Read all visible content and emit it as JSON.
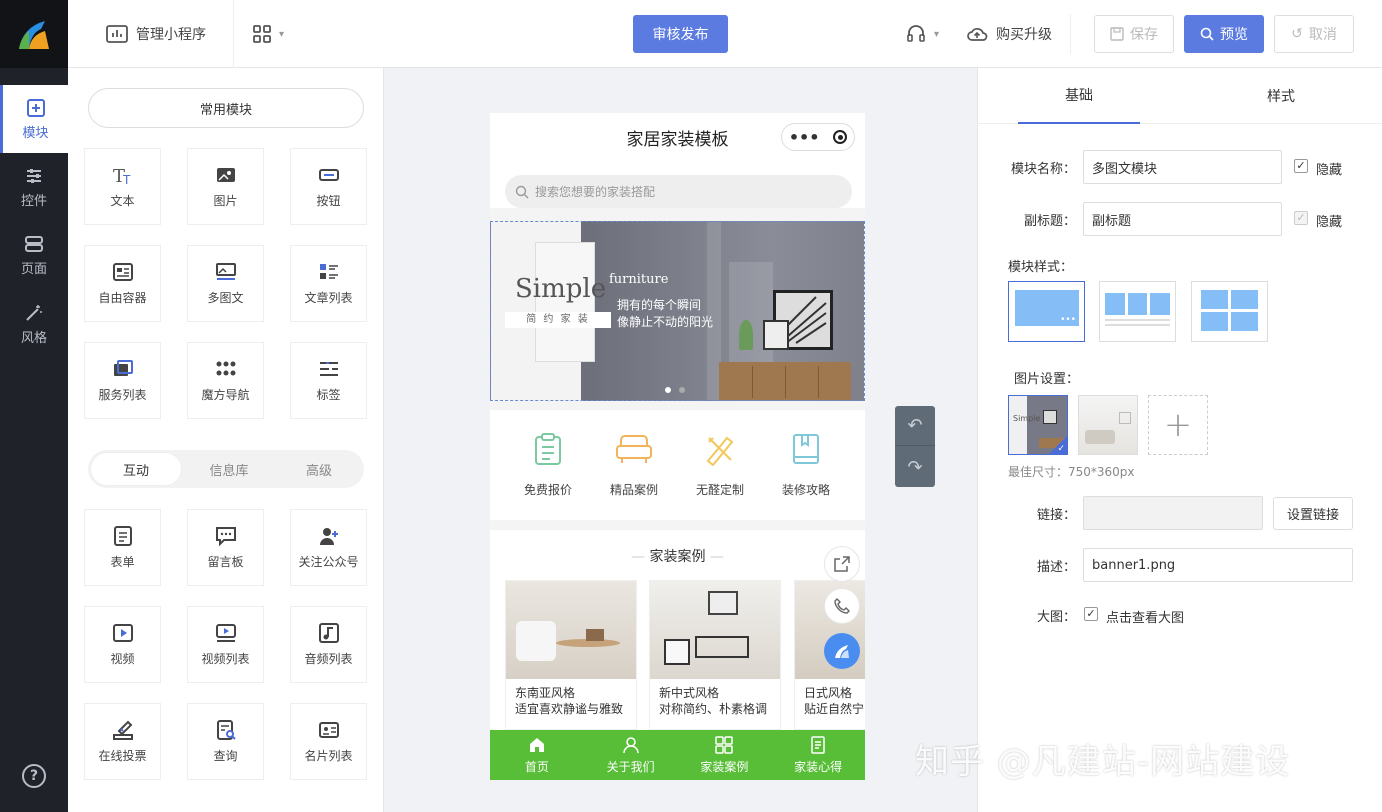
{
  "rail": {
    "items": [
      {
        "label": "模块",
        "icon": "plus-square-icon"
      },
      {
        "label": "控件",
        "icon": "sliders-icon"
      },
      {
        "label": "页面",
        "icon": "pages-icon"
      },
      {
        "label": "风格",
        "icon": "magic-wand-icon"
      }
    ],
    "help_icon": "help-icon"
  },
  "topbar": {
    "manage_label": "管理小程序",
    "publish_label": "审核发布",
    "upgrade_label": "购买升级",
    "save_label": "保存",
    "preview_label": "预览",
    "cancel_label": "取消"
  },
  "modules": {
    "common_label": "常用模块",
    "common": [
      "文本",
      "图片",
      "按钮",
      "自由容器",
      "多图文",
      "文章列表",
      "服务列表",
      "魔方导航",
      "标签"
    ],
    "tabs": [
      "互动",
      "信息库",
      "高级"
    ],
    "interactive": [
      "表单",
      "留言板",
      "关注公众号",
      "视频",
      "视频列表",
      "音频列表",
      "在线投票",
      "查询",
      "名片列表"
    ]
  },
  "phone": {
    "title": "家居家装模板",
    "search_placeholder": "搜索您想要的家装搭配",
    "banner": {
      "simple": "Simple",
      "furniture": "furniture",
      "line1": "拥有的每个瞬间",
      "line2": "像静止不动的阳光",
      "tag": "简 约 家 装"
    },
    "nav": [
      "免费报价",
      "精品案例",
      "无醛定制",
      "装修攻略"
    ],
    "section_title": "家装案例",
    "cases": [
      {
        "title": "东南亚风格",
        "desc": "适宜喜欢静谧与雅致"
      },
      {
        "title": "新中式风格",
        "desc": "对称简约、朴素格调"
      },
      {
        "title": "日式风格",
        "desc": "贴近自然宁"
      }
    ],
    "tabbar": [
      "首页",
      "关于我们",
      "家装案例",
      "家装心得"
    ]
  },
  "props": {
    "tabs": [
      "基础",
      "样式"
    ],
    "name_label": "模块名称：",
    "name_value": "多图文模块",
    "hide_label": "隐藏",
    "subtitle_label": "副标题：",
    "subtitle_value": "副标题",
    "style_label": "模块样式：",
    "image_label": "图片设置：",
    "best_size": "最佳尺寸：750*360px",
    "link_label": "链接：",
    "set_link": "设置链接",
    "desc_label": "描述：",
    "desc_value": "banner1.png",
    "big_label": "大图：",
    "big_value": "点击查看大图"
  },
  "watermark": "知乎 @凡建站-网站建设",
  "colors": {
    "accent": "#4a6cd6",
    "green": "#58bd37",
    "rail": "#1f2229"
  }
}
